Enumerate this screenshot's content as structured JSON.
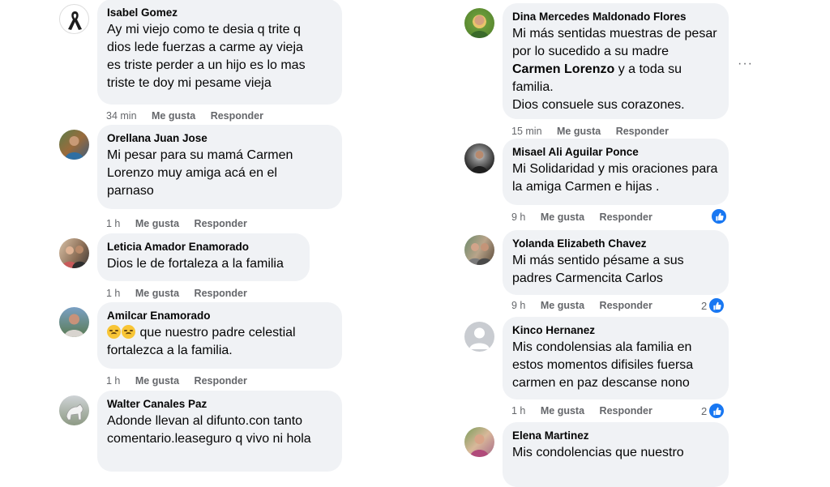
{
  "labels": {
    "like": "Me gusta",
    "reply": "Responder"
  },
  "colors": {
    "bubble": "#f0f2f5",
    "meta": "#65676b",
    "like_blue": "#1877f2"
  },
  "left_column": [
    {
      "name": "Isabel Gomez",
      "lines": [
        "Ay mi viejo como te desia q trite q",
        "dios lede fuerzas a carme ay vieja",
        "es triste perder a un hijo es lo mas",
        "triste te doy mi pesame vieja"
      ],
      "time": "34 min",
      "avatar": "black-ribbon-avatar"
    },
    {
      "name": "Orellana Juan Jose",
      "lines": [
        "Mi pesar para su mamá Carmen",
        "Lorenzo muy amiga acá en el",
        "parnaso"
      ],
      "time": "1 h",
      "avatar": "photo-avatar"
    },
    {
      "name": "Leticia Amador Enamorado",
      "lines": [
        "Dios le de fortaleza a la familia"
      ],
      "time": "1 h",
      "avatar": "photo-avatar"
    },
    {
      "name": "Amilcar Enamorado",
      "lines": [
        " que nuestro padre celestial",
        "fortalezca a la familia."
      ],
      "time": "1 h",
      "avatar": "photo-avatar",
      "emoji": "sad-face-emoji"
    },
    {
      "name": "Walter Canales Paz",
      "lines": [
        "Adonde llevan al difunto.con tanto",
        "comentario.leaseguro q vivo ni hola"
      ],
      "avatar": "photo-avatar"
    }
  ],
  "right_column": [
    {
      "name": "Dina Mercedes Maldonado Flores",
      "lines_a": [
        "Mi más sentidas muestras de pesar",
        "por lo sucedido a su madre"
      ],
      "mention": "Carmen Lorenzo",
      "mention_rest": " y a toda su",
      "lines_b": [
        "familia.",
        "Dios consuele sus corazones."
      ],
      "time": "15 min",
      "avatar": "photo-avatar"
    },
    {
      "name": "Misael Ali Aguilar Ponce",
      "lines": [
        "Mi Solidaridad y mis oraciones para",
        "la amiga Carmen e hijas ."
      ],
      "time": "9 h",
      "avatar": "photo-avatar"
    },
    {
      "name": "Yolanda Elizabeth Chavez",
      "lines": [
        "Mi más sentido pésame a sus",
        "padres Carmencita Carlos"
      ],
      "time": "9 h",
      "avatar": "photo-avatar",
      "reactions": "2"
    },
    {
      "name": "Kinco Hernanez",
      "lines": [
        "Mis condolensias ala familia en",
        "estos momentos difisiles fuersa",
        "carmen en paz descanse nono"
      ],
      "time": "1 h",
      "avatar": "default-person-avatar",
      "reactions": "2"
    },
    {
      "name": "Elena Martinez",
      "lines": [
        "Mis condolencias que nuestro"
      ],
      "avatar": "photo-avatar"
    }
  ],
  "more_options": "···"
}
